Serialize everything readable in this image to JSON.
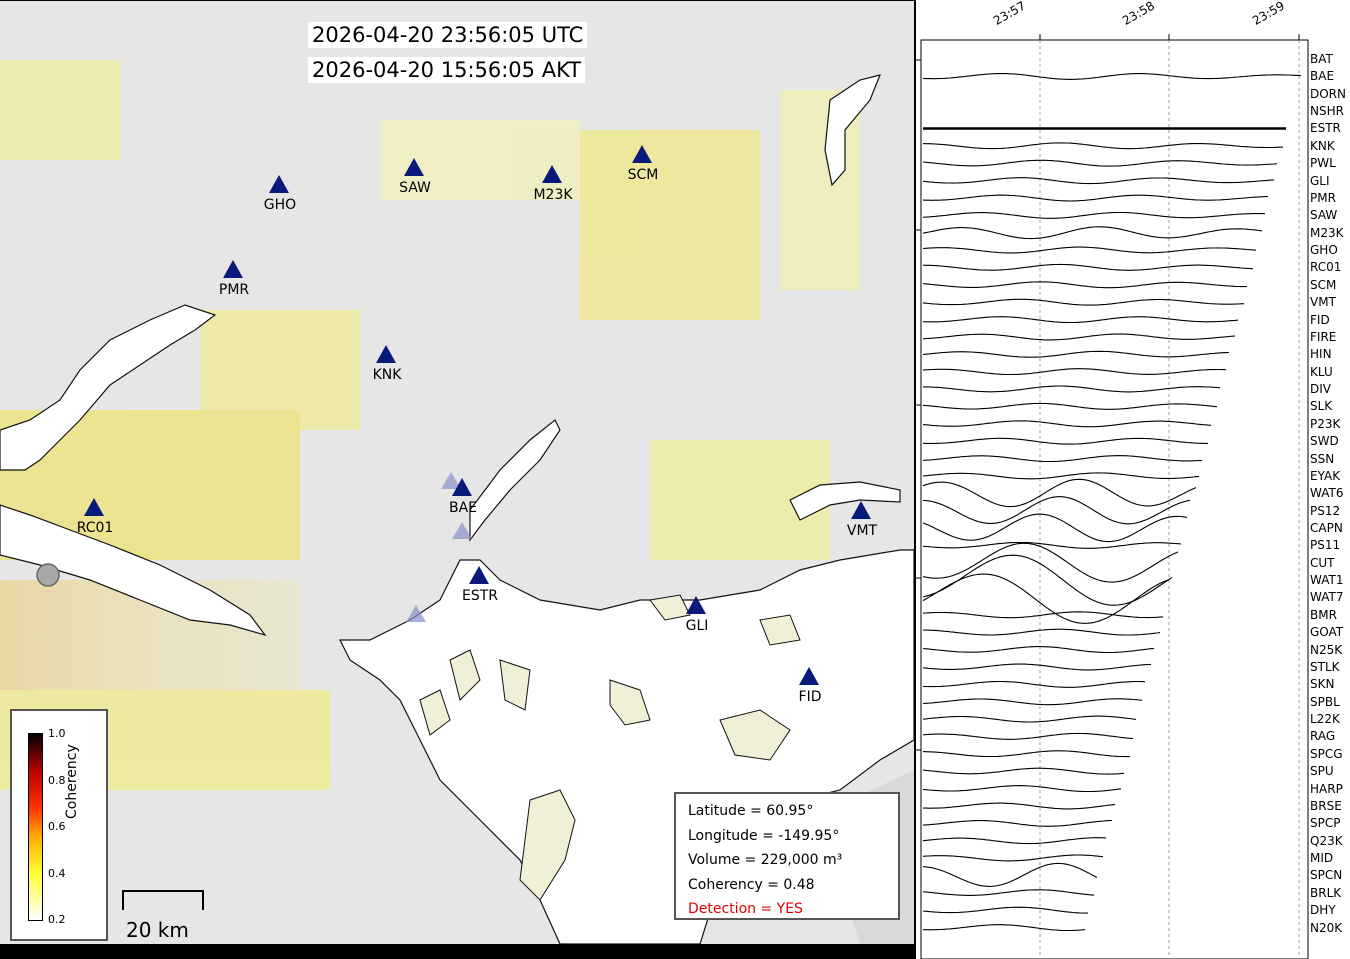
{
  "header": {
    "utc_time": "2026-04-20 23:56:05 UTC",
    "local_time": "2026-04-20 15:56:05 AKT"
  },
  "stations": [
    {
      "code": "GHO"
    },
    {
      "code": "SAW"
    },
    {
      "code": "M23K"
    },
    {
      "code": "SCM"
    },
    {
      "code": "PMR"
    },
    {
      "code": "KNK"
    },
    {
      "code": "BAE"
    },
    {
      "code": "RC01"
    },
    {
      "code": "ESTR"
    },
    {
      "code": "VMT"
    },
    {
      "code": "GLI"
    },
    {
      "code": "FID"
    }
  ],
  "info": {
    "latitude": "Latitude = 60.95°",
    "longitude": "Longitude = -149.95°",
    "volume": "Volume = 229,000 m³",
    "coherency": "Coherency = 0.48",
    "detection": "Detection = YES"
  },
  "colorbar": {
    "title": "Coherency",
    "ticks": [
      "1.0",
      "0.8",
      "0.6",
      "0.4",
      "0.2"
    ]
  },
  "scalebar": {
    "label": "20 km"
  },
  "time_axis": {
    "ticks": [
      "23:57",
      "23:58",
      "23:59"
    ]
  },
  "trace_stations": [
    "BAT",
    "BAE",
    "DORN",
    "NSHR",
    "ESTR",
    "KNK",
    "PWL",
    "GLI",
    "PMR",
    "SAW",
    "M23K",
    "GHO",
    "RC01",
    "SCM",
    "VMT",
    "FID",
    "FIRE",
    "HIN",
    "KLU",
    "DIV",
    "SLK",
    "P23K",
    "SWD",
    "SSN",
    "EYAK",
    "WAT6",
    "PS12",
    "CAPN",
    "PS11",
    "CUT",
    "WAT1",
    "WAT7",
    "BMR",
    "GOAT",
    "N25K",
    "STLK",
    "SKN",
    "SPBL",
    "L22K",
    "RAG",
    "SPCG",
    "SPU",
    "HARP",
    "BRSE",
    "SPCP",
    "Q23K",
    "MID",
    "SPCN",
    "BRLK",
    "DHY",
    "N20K"
  ],
  "colors": {
    "station": "#0a1a7a",
    "detection": "#e00000",
    "water": "#ffffff",
    "land": "#e8e8e8",
    "coherency_low": "#ffff66"
  }
}
